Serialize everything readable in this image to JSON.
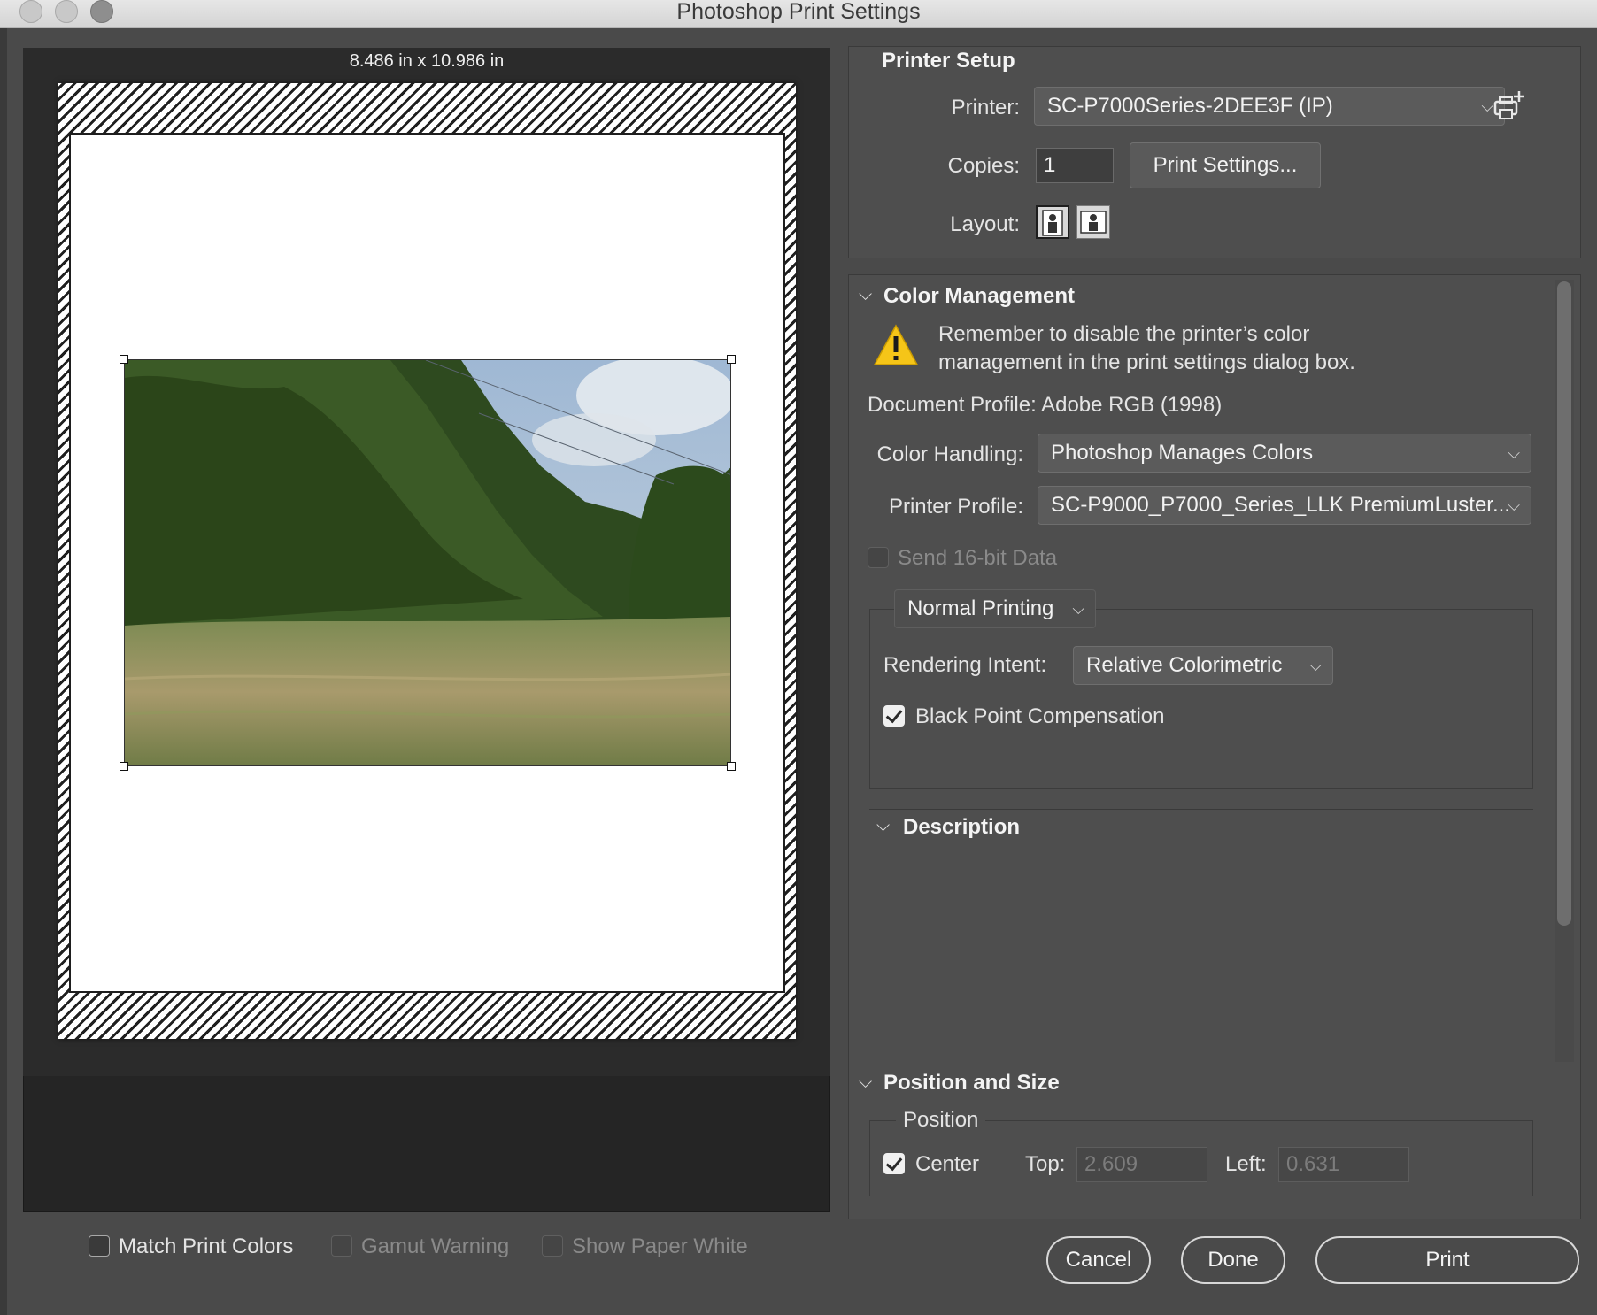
{
  "window": {
    "title": "Photoshop Print Settings"
  },
  "preview": {
    "size_label": "8.486 in x 10.986 in"
  },
  "printer_setup": {
    "title": "Printer Setup",
    "printer_label": "Printer:",
    "printer_value": "SC-P7000Series-2DEE3F (IP)",
    "copies_label": "Copies:",
    "copies_value": "1",
    "print_settings_button": "Print Settings...",
    "layout_label": "Layout:"
  },
  "color_management": {
    "title": "Color Management",
    "warning_line1": "Remember to disable the printer’s color",
    "warning_line2": "management in the print settings dialog box.",
    "document_profile": "Document Profile: Adobe RGB (1998)",
    "color_handling_label": "Color Handling:",
    "color_handling_value": "Photoshop Manages Colors",
    "printer_profile_label": "Printer Profile:",
    "printer_profile_value": "SC-P9000_P7000_Series_LLK PremiumLuster...",
    "send16_label": "Send 16-bit Data",
    "normal_printing": "Normal Printing",
    "rendering_intent_label": "Rendering Intent:",
    "rendering_intent_value": "Relative Colorimetric",
    "bpc_label": "Black Point Compensation"
  },
  "description": {
    "title": "Description"
  },
  "position_size": {
    "title": "Position and Size",
    "position_label": "Position",
    "center_label": "Center",
    "top_label": "Top:",
    "top_value": "2.609",
    "left_label": "Left:",
    "left_value": "0.631"
  },
  "bottom": {
    "match_print_colors": "Match Print Colors",
    "gamut_warning": "Gamut Warning",
    "show_paper_white": "Show Paper White",
    "cancel": "Cancel",
    "done": "Done",
    "print": "Print"
  },
  "icons": {
    "printer_add": "printer-add-icon",
    "warning": "warning-icon",
    "layout_portrait": "layout-portrait-icon",
    "layout_landscape": "layout-landscape-icon"
  },
  "colors": {
    "panel": "#4e4e4e",
    "preview_bg": "#2b2b2b",
    "warning": "#f5c518"
  }
}
